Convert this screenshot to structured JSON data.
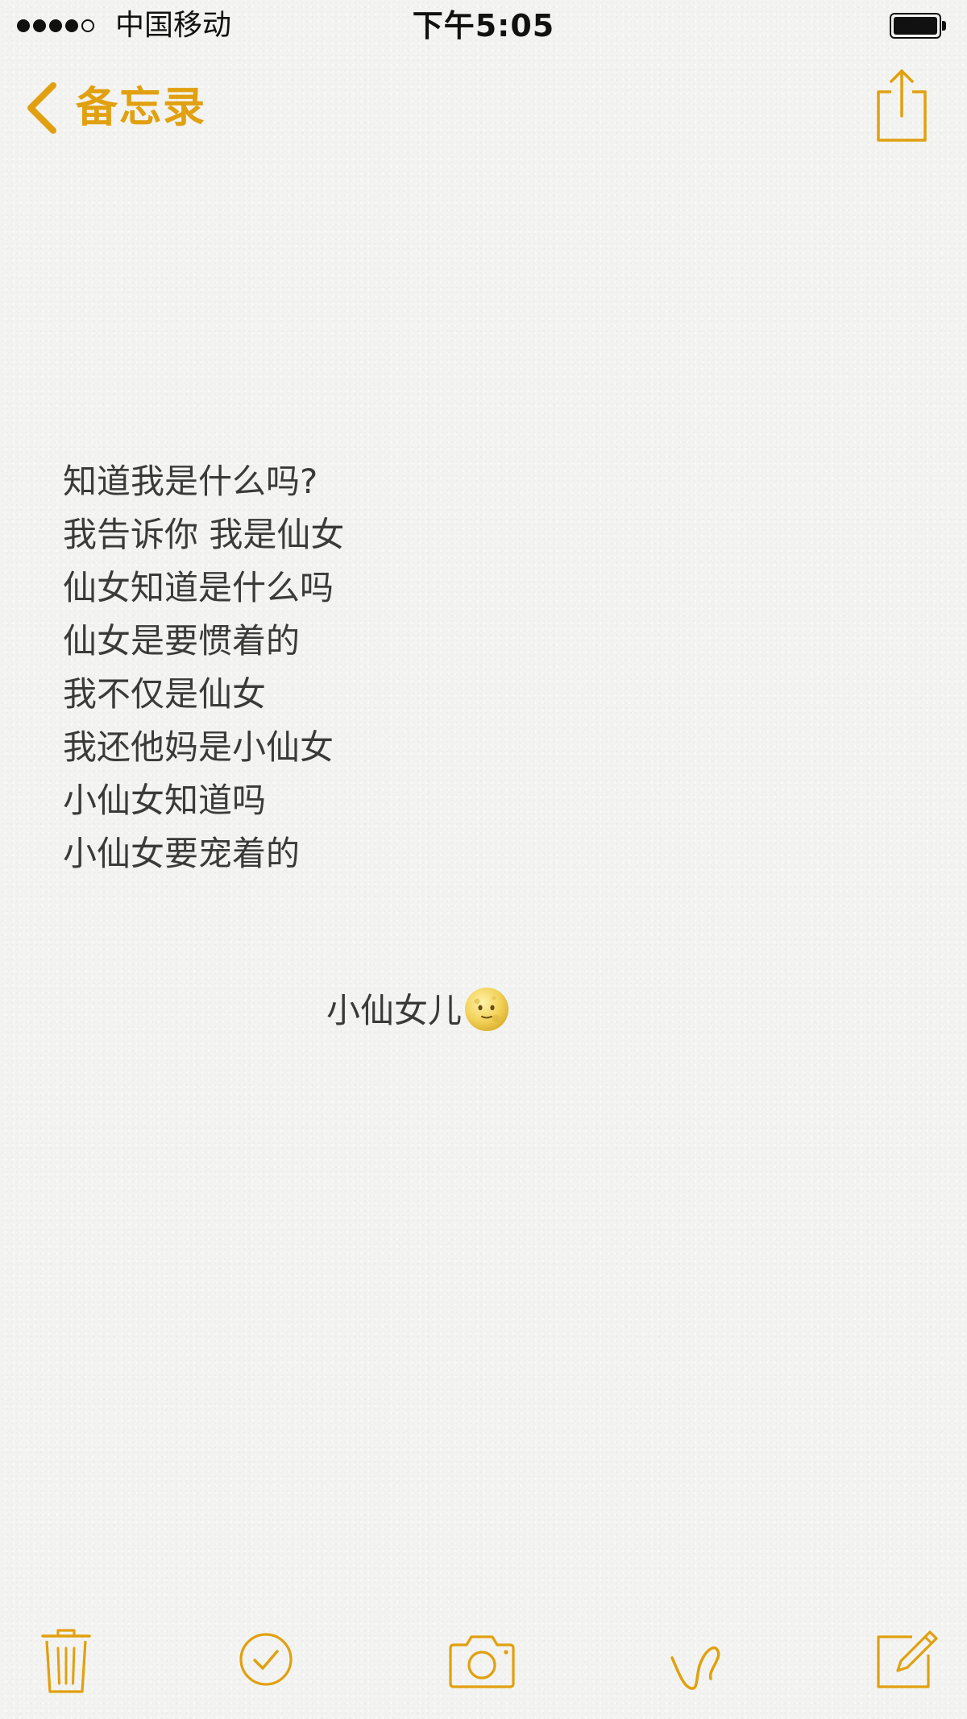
{
  "status_bar": {
    "carrier": "中国移动",
    "time": "下午5:05",
    "signal_total": 5,
    "signal_filled": 4,
    "battery_level": 1.0
  },
  "nav": {
    "back_label": "备忘录",
    "back_icon": "chevron-left-icon",
    "share_icon": "share-icon"
  },
  "note": {
    "lines": [
      "知道我是什么吗?",
      "我告诉你 我是仙女",
      "仙女知道是什么吗",
      "仙女是要惯着的",
      "我不仅是仙女",
      "我还他妈是小仙女",
      "小仙女知道吗",
      "小仙女要宠着的"
    ],
    "signature": "小仙女儿",
    "signature_emoji": "new-moon-face-emoji"
  },
  "toolbar": {
    "items": [
      "trash-icon",
      "checklist-icon",
      "camera-icon",
      "sketch-icon",
      "compose-icon"
    ]
  },
  "colors": {
    "accent": "#e1a00f",
    "text": "#3a3a3a",
    "status": "#111111",
    "paper": "#f3f3f1"
  }
}
